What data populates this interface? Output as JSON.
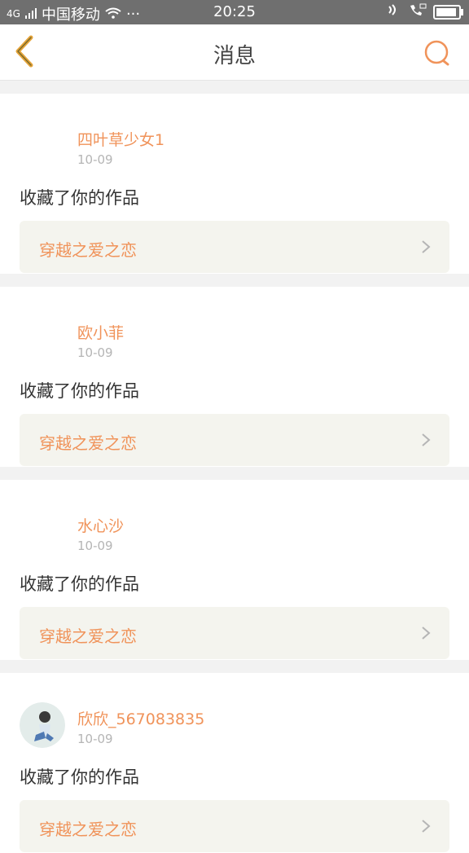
{
  "status_bar": {
    "signal": "4G",
    "carrier": "中国移动",
    "more": "···",
    "time": "20:25"
  },
  "nav": {
    "title": "消息",
    "back_icon": "back-chevron-icon",
    "search_icon": "search-icon",
    "accent": "#f0a23a"
  },
  "messages": [
    {
      "user": "四叶草少女1",
      "date": "10-09",
      "action": "收藏了你的作品",
      "work": "穿越之爱之恋"
    },
    {
      "user": "欧小菲",
      "date": "10-09",
      "action": "收藏了你的作品",
      "work": "穿越之爱之恋"
    },
    {
      "user": "水心沙",
      "date": "10-09",
      "action": "收藏了你的作品",
      "work": "穿越之爱之恋"
    },
    {
      "user": "欣欣_567083835",
      "date": "10-09",
      "action": "收藏了你的作品",
      "work": "穿越之爱之恋"
    }
  ]
}
